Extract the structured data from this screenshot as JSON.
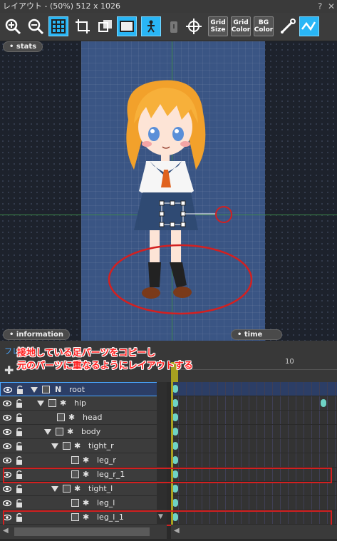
{
  "window": {
    "title": "レイアウト - (50%) 512 x 1026",
    "help": "?",
    "close": "✕"
  },
  "toolbar": {
    "buttons": [
      {
        "name": "zoom-in-button",
        "icon": "zoom-in-icon"
      },
      {
        "name": "zoom-out-button",
        "icon": "zoom-out-icon"
      },
      {
        "name": "grid-toggle-button",
        "icon": "grid-icon"
      },
      {
        "name": "crop-button",
        "icon": "crop-icon"
      },
      {
        "name": "layer-button",
        "icon": "layer-icon"
      },
      {
        "name": "frame-button",
        "icon": "frame-icon"
      },
      {
        "name": "bone-button",
        "icon": "bone-icon"
      },
      {
        "name": "lock-button",
        "icon": "lock-icon"
      },
      {
        "name": "crosshair-button",
        "icon": "crosshair-icon"
      }
    ],
    "grid_size": [
      "Grid",
      "Size"
    ],
    "grid_color": [
      "Grid",
      "Color"
    ],
    "bg_color": [
      "BG",
      "Color"
    ]
  },
  "canvas": {
    "tab_stats": "• stats",
    "tab_information": "• information",
    "tab_time": "• time",
    "stage_color": "#3a5584"
  },
  "annotation": {
    "line1": "接地している足パーツをコピーし",
    "line2": "元のパーツに重なるようにレイアウトする",
    "color": "#ff2020"
  },
  "timeline": {
    "tab_label": "フレ",
    "ruler_mark": "10",
    "rows": [
      {
        "label": "root",
        "prefix": "N",
        "selected": true
      },
      {
        "label": "hip"
      },
      {
        "label": "head"
      },
      {
        "label": "body"
      },
      {
        "label": "tight_r"
      },
      {
        "label": "leg_r"
      },
      {
        "label": "leg_r_1",
        "highlight": true
      },
      {
        "label": "tight_l"
      },
      {
        "label": "leg_l"
      },
      {
        "label": "leg_l_1",
        "highlight": true
      }
    ],
    "keyframe_color": "#6fd3c5",
    "playhead_color": "#a8a020"
  }
}
